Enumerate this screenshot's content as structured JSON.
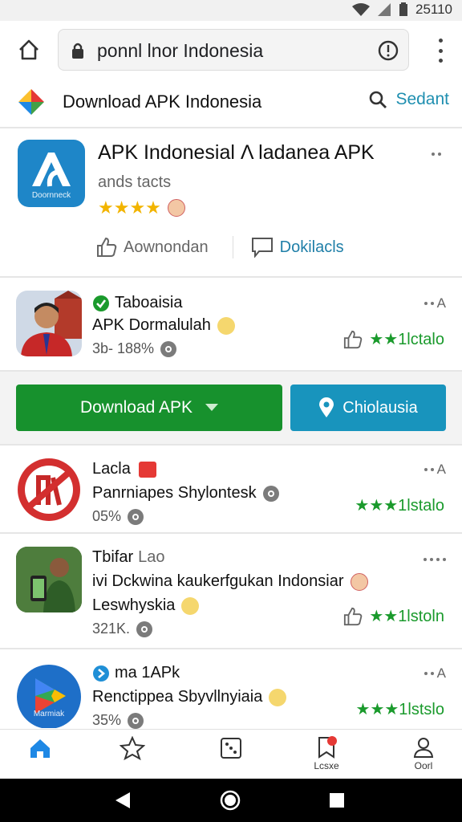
{
  "status_bar": {
    "time": "25110"
  },
  "browser": {
    "url_text": "ponnl lnor Indonesia",
    "icons": [
      "home-icon",
      "lock-icon",
      "info-icon",
      "more-vert-icon"
    ]
  },
  "site_header": {
    "title": "Download APK Indonesia",
    "search_label": "Sedant"
  },
  "main_app": {
    "title": "APK Indonesial Λ ladanea APK",
    "subtitle": "ands tacts",
    "icon_caption": "Doornneck",
    "stars": "★★★★",
    "actions": {
      "like_label": "Aownondan",
      "comment_label": "Dokilacls"
    }
  },
  "list_items": [
    {
      "line1": "Taboaisia",
      "line2": "APK Dormalulah",
      "line3": "3b- 188%",
      "corner": "A",
      "rating": "★★1lctalo"
    },
    {
      "line1": "Lacla",
      "line2": "Panrniapes Shylontesk",
      "line3": "05%",
      "corner": "A",
      "rating": "★★★1lstalo"
    },
    {
      "line1": "Tbifar",
      "line1_suffix": "Lao",
      "line2": "ivi Dckwina kaukerfgukan Indonsiar",
      "line3": "Leswhyskia",
      "line4": "321K.",
      "rating": "★★1lstoln"
    },
    {
      "line1": "ma 1APk",
      "line2": "Renctippea Sbyvllnyiaia",
      "line3": "35%",
      "corner": "A",
      "rating": "★★★1lstslo",
      "icon_caption": "Marmiak"
    }
  ],
  "buttons": {
    "download": "Download APK",
    "location": "Chiolausia"
  },
  "bottom_nav": [
    {
      "label": "",
      "icon": "home-icon"
    },
    {
      "label": "",
      "icon": "star-icon"
    },
    {
      "label": "",
      "icon": "dice-icon"
    },
    {
      "label": "Lcsxe",
      "icon": "bookmark-icon"
    },
    {
      "label": "Oorl",
      "icon": "profile-icon"
    }
  ],
  "colors": {
    "accent_green": "#17912d",
    "accent_blue": "#1894bd",
    "link_blue": "#1f8fb0",
    "star_gold": "#f2b400",
    "rating_green": "#1a9a2c"
  }
}
